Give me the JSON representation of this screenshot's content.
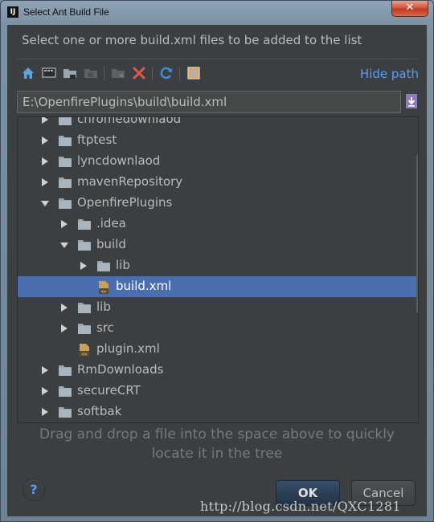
{
  "window": {
    "title": "Select Ant Build File",
    "app_icon_label": "IJ",
    "close_glyph": "✕"
  },
  "dialog": {
    "instruction": "Select one or more build.xml files to be added to the list",
    "hide_path_link": "Hide path",
    "path_value": "E:\\OpenfirePlugins\\build\\build.xml",
    "drag_hint_line1": "Drag and drop a file into the space above to quickly",
    "drag_hint_line2": "locate it in the tree",
    "help_glyph": "?",
    "ok_label": "OK",
    "cancel_label": "Cancel"
  },
  "toolbar_icons": [
    "home-icon",
    "desktop-icon",
    "project-folder-icon",
    "module-folder-icon",
    "new-folder-icon",
    "delete-icon",
    "refresh-icon",
    "show-hidden-icon"
  ],
  "tree": {
    "rows": [
      {
        "label": "chromedownlaod",
        "level": 0,
        "arrow": "right",
        "icon": "folder",
        "selected": false
      },
      {
        "label": "ftptest",
        "level": 0,
        "arrow": "right",
        "icon": "folder",
        "selected": false
      },
      {
        "label": "lyncdownlaod",
        "level": 0,
        "arrow": "right",
        "icon": "folder",
        "selected": false
      },
      {
        "label": "mavenRepository",
        "level": 0,
        "arrow": "right",
        "icon": "folder",
        "selected": false
      },
      {
        "label": "OpenfirePlugins",
        "level": 0,
        "arrow": "down",
        "icon": "folder",
        "selected": false
      },
      {
        "label": ".idea",
        "level": 1,
        "arrow": "right",
        "icon": "folder",
        "selected": false
      },
      {
        "label": "build",
        "level": 1,
        "arrow": "down",
        "icon": "folder",
        "selected": false
      },
      {
        "label": "lib",
        "level": 2,
        "arrow": "right",
        "icon": "folder",
        "selected": false
      },
      {
        "label": "build.xml",
        "level": 2,
        "arrow": "none",
        "icon": "xml",
        "selected": true
      },
      {
        "label": "lib",
        "level": 1,
        "arrow": "right",
        "icon": "folder",
        "selected": false
      },
      {
        "label": "src",
        "level": 1,
        "arrow": "right",
        "icon": "folder",
        "selected": false
      },
      {
        "label": "plugin.xml",
        "level": 1,
        "arrow": "none",
        "icon": "xml",
        "selected": false
      },
      {
        "label": "RmDownloads",
        "level": 0,
        "arrow": "right",
        "icon": "folder",
        "selected": false
      },
      {
        "label": "secureCRT",
        "level": 0,
        "arrow": "right",
        "icon": "folder",
        "selected": false
      },
      {
        "label": "softbak",
        "level": 0,
        "arrow": "right",
        "icon": "folder",
        "selected": false
      }
    ]
  },
  "watermark": "http://blog.csdn.net/QXC1281",
  "colors": {
    "background": "#3c3f41",
    "selection": "#4b6eaf",
    "link": "#589df6",
    "text": "#bbbbbb",
    "delete_red": "#e05a46",
    "refresh_blue": "#3f8ede"
  }
}
